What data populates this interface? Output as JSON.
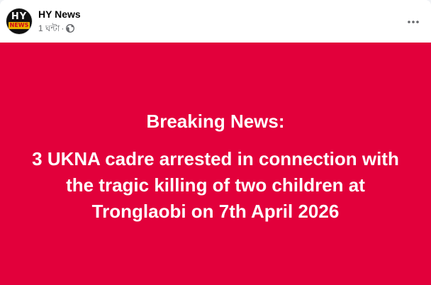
{
  "post": {
    "author": "HY News",
    "avatar_text_top": "HY",
    "avatar_text_bottom": "NEWS",
    "time": "1 ঘন্টা",
    "separator": "·",
    "privacy_icon": "globe-icon",
    "more_icon": "more-options-icon"
  },
  "content": {
    "background_color": "#e2003b",
    "headline": "Breaking News:",
    "story_lines": [
      "3 UKNA cadre arrested in connection with",
      "the tragic killing of two children at",
      "Tronglaobi on 7th April 2026"
    ]
  }
}
